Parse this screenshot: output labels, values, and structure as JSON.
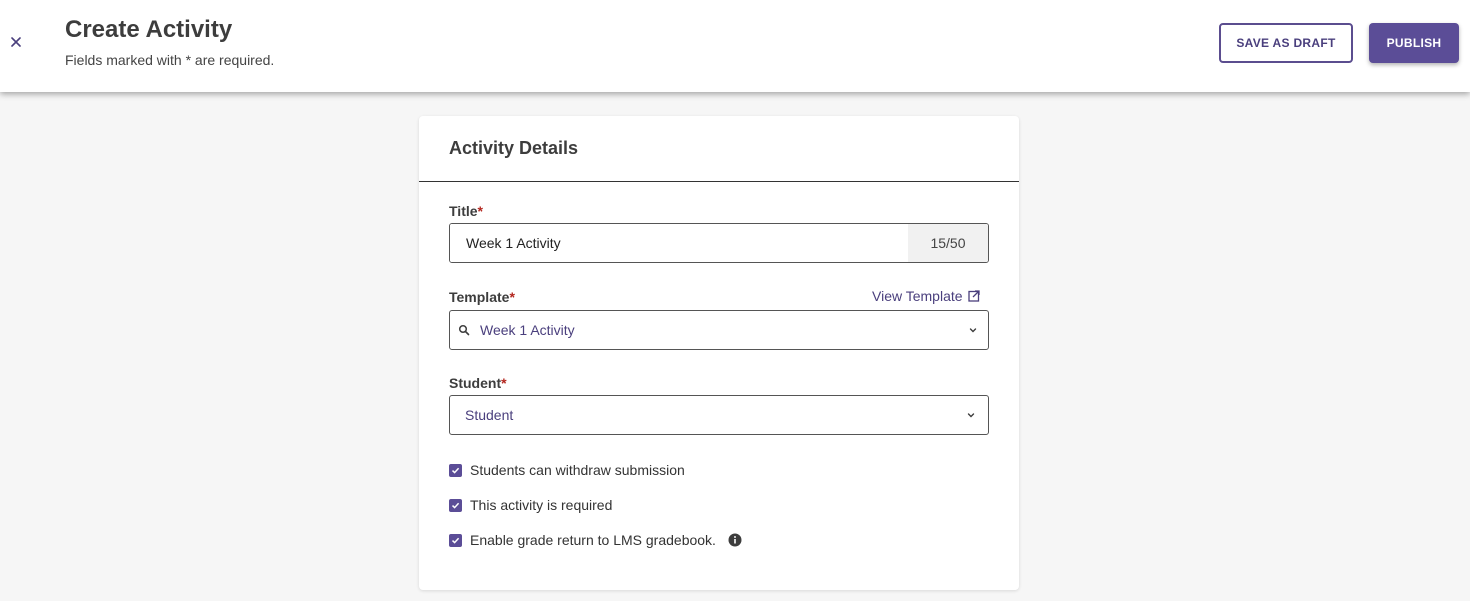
{
  "header": {
    "title": "Create Activity",
    "subtitle": "Fields marked with * are required.",
    "close_icon": "close-icon",
    "save_draft_label": "SAVE AS DRAFT",
    "publish_label": "PUBLISH"
  },
  "card": {
    "title": "Activity Details",
    "title_field": {
      "label": "Title",
      "required_mark": "*",
      "value": "Week 1 Activity",
      "char_count": "15/50"
    },
    "template_field": {
      "label": "Template",
      "required_mark": "*",
      "view_template_label": "View Template",
      "selected": "Week 1 Activity",
      "icons": [
        "search-icon",
        "external-link-icon",
        "chevron-down-icon"
      ]
    },
    "student_field": {
      "label": "Student",
      "required_mark": "*",
      "selected": "Student"
    },
    "options": [
      {
        "label": "Students can withdraw submission",
        "checked": true
      },
      {
        "label": "This activity is required",
        "checked": true
      },
      {
        "label": "Enable grade return to LMS gradebook.",
        "checked": true,
        "info_icon": "info-icon"
      }
    ]
  },
  "colors": {
    "accent": "#5b4d97",
    "accent_text": "#4a3f7d",
    "required": "#b3261e",
    "background": "#f6f6f6"
  }
}
